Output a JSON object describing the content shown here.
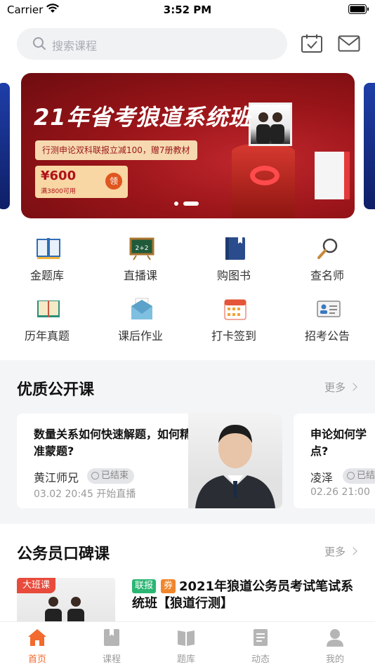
{
  "status_bar": {
    "carrier": "Carrier",
    "time": "3:52 PM"
  },
  "search": {
    "placeholder": "搜索课程"
  },
  "banner": {
    "title": "21年省考狼道系统班",
    "subtitle": "行测申论双科联报立减100，赠7册教材",
    "coupon_price": "¥600",
    "coupon_condition": "满3800可用",
    "coupon_claim": "领",
    "active_slide": 2,
    "slide_count": 2
  },
  "quick_grid": [
    {
      "label": "金题库",
      "icon": "open-book-icon"
    },
    {
      "label": "直播课",
      "icon": "blackboard-icon",
      "icon_text": "2+2"
    },
    {
      "label": "购图书",
      "icon": "book-icon"
    },
    {
      "label": "查名师",
      "icon": "magnifier-icon"
    },
    {
      "label": "历年真题",
      "icon": "textbook-icon"
    },
    {
      "label": "课后作业",
      "icon": "envelope-letter-icon"
    },
    {
      "label": "打卡签到",
      "icon": "calendar-checkin-icon"
    },
    {
      "label": "招考公告",
      "icon": "id-card-icon"
    }
  ],
  "open_courses": {
    "title": "优质公开课",
    "more": "更多",
    "cards": [
      {
        "title": "数量关系如何快速解题，如何精准蒙题?",
        "teacher": "黄江师兄",
        "status": "已结束",
        "time": "03.02 20:45 开始直播"
      },
      {
        "title": "申论如何学点?",
        "teacher": "凌泽",
        "status": "已结",
        "time": "02.26 21:00"
      }
    ]
  },
  "word_of_mouth": {
    "title": "公务员口碑课",
    "more": "更多",
    "course": {
      "badge": "大班课",
      "tag_joint": "联报",
      "tag_coupon": "券",
      "title": "2021年狼道公务员考试笔试系统班【狼道行测】"
    }
  },
  "tab_bar": [
    {
      "label": "首页",
      "icon": "home-icon",
      "active": true
    },
    {
      "label": "课程",
      "icon": "bookmark-book-icon",
      "active": false
    },
    {
      "label": "题库",
      "icon": "open-book-icon",
      "active": false
    },
    {
      "label": "动态",
      "icon": "document-icon",
      "active": false
    },
    {
      "label": "我的",
      "icon": "person-icon",
      "active": false
    }
  ],
  "colors": {
    "accent": "#f26a2e",
    "banner_red": "#9a1519",
    "tag_green": "#2bb673",
    "tag_orange": "#f0862c"
  }
}
